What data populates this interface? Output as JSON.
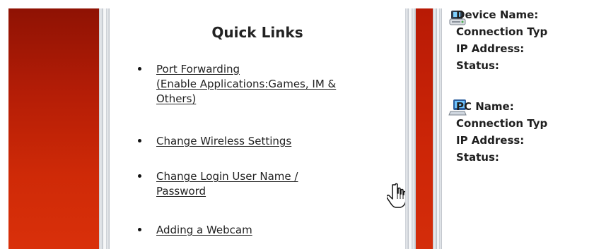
{
  "quick_links": {
    "title": "Quick Links",
    "items": [
      {
        "line1": "Port Forwarding ",
        "line2": "(Enable Applications:Games, IM &",
        "line3": "Others)"
      },
      {
        "line1": "Change Wireless Settings"
      },
      {
        "line1": "Change Login User Name /",
        "line2": "Password"
      },
      {
        "line1": "Adding a Webcam"
      }
    ]
  },
  "device_status": {
    "device_name_label": "Device Name:",
    "connection_type_label": "Connection Typ",
    "ip_address_label": "IP Address:",
    "status_label": "Status:"
  },
  "pc_status": {
    "pc_name_label": "PC Name:",
    "connection_type_label": "Connection Typ",
    "ip_address_label": "IP Address:",
    "status_label": "Status:"
  },
  "colors": {
    "brand_red": "#c5270a",
    "dark_red": "#8f1204",
    "text": "#222222"
  },
  "icons": {
    "device": "router-device-icon",
    "pc": "computer-icon",
    "cursor": "hand-pointer-icon"
  }
}
